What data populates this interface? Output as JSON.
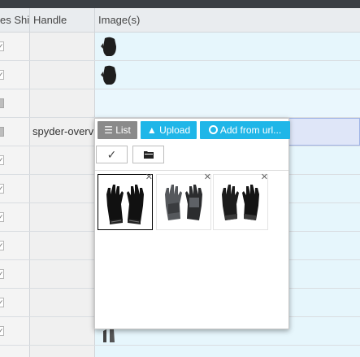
{
  "header": {
    "col_ship_label": "es Shi",
    "col_handle_label": "Handle",
    "col_images_label": "Image(s)"
  },
  "rows": [
    {
      "handle": "",
      "checkbox": "checked",
      "has_image": true
    },
    {
      "handle": "",
      "checkbox": "checked",
      "has_image": true
    },
    {
      "handle": "",
      "checkbox": "grey",
      "has_image": false
    },
    {
      "handle": "spyder-overv",
      "checkbox": "grey",
      "has_image": false,
      "selected": true
    },
    {
      "handle": "",
      "checkbox": "checked",
      "has_image": false
    },
    {
      "handle": "",
      "checkbox": "checked",
      "has_image": false
    },
    {
      "handle": "",
      "checkbox": "checked",
      "has_image": false
    },
    {
      "handle": "",
      "checkbox": "checked",
      "has_image": false
    },
    {
      "handle": "",
      "checkbox": "checked",
      "has_image": false
    },
    {
      "handle": "",
      "checkbox": "checked",
      "has_image": false
    },
    {
      "handle": "",
      "checkbox": "checked",
      "has_image": true
    }
  ],
  "popup": {
    "list_label": "☰ List",
    "upload_label": "▲ Upload",
    "add_url_label": "Add from url...",
    "check_symbol": "✓",
    "folder_symbol": "▬",
    "remove_symbol": "✕",
    "images": [
      {
        "icon": "black-glove-pair",
        "selected": true
      },
      {
        "icon": "grey-glove-pair",
        "selected": false
      },
      {
        "icon": "black-glove-pair",
        "selected": false
      }
    ]
  },
  "colors": {
    "accent": "#1fb6e8",
    "row_bg": "#e6f6fc",
    "selected_row_bg": "#dfe6f8",
    "topbar": "#3a3f44"
  }
}
